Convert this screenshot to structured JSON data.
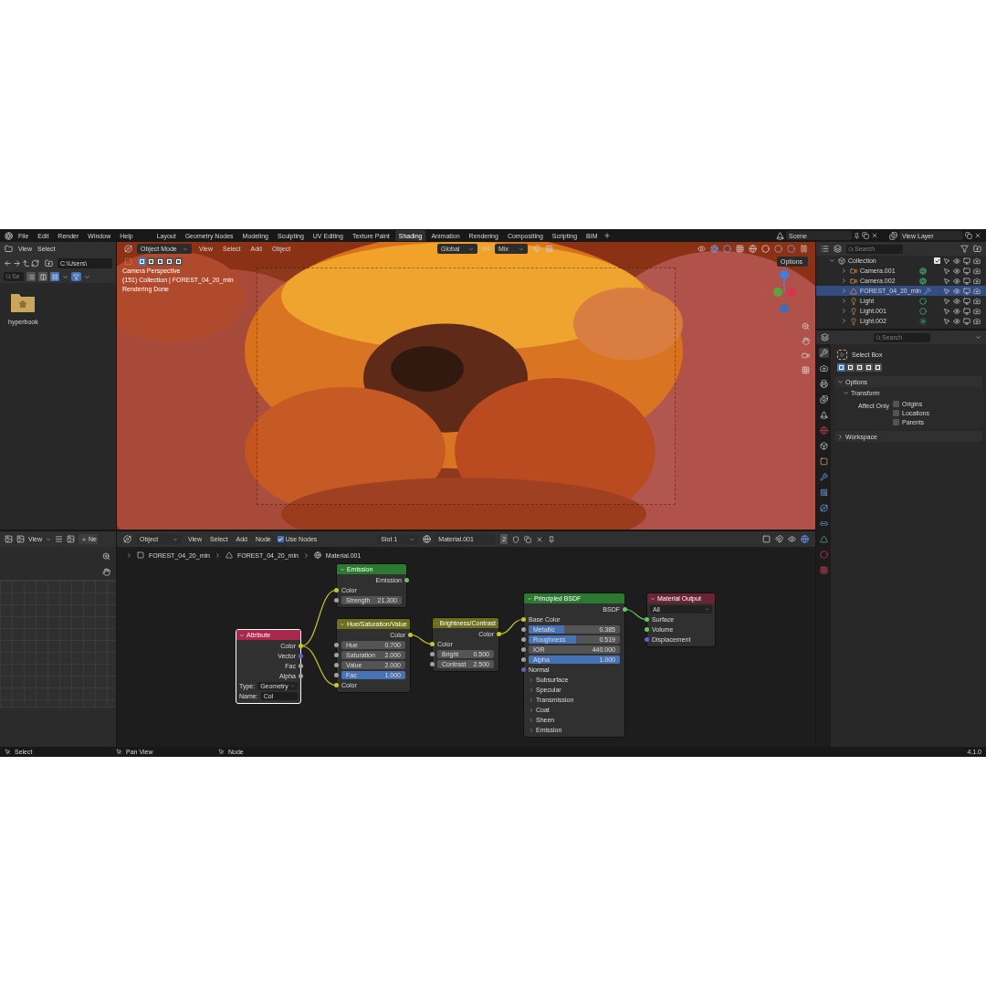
{
  "menu": [
    "File",
    "Edit",
    "Render",
    "Window",
    "Help"
  ],
  "workspaces": [
    {
      "label": "Layout",
      "selected": false
    },
    {
      "label": "Geometry Nodes",
      "selected": false
    },
    {
      "label": "Modeling",
      "selected": false
    },
    {
      "label": "Sculpting",
      "selected": false
    },
    {
      "label": "UV Editing",
      "selected": false
    },
    {
      "label": "Texture Paint",
      "selected": false
    },
    {
      "label": "Shading",
      "selected": true
    },
    {
      "label": "Animation",
      "selected": false
    },
    {
      "label": "Rendering",
      "selected": false
    },
    {
      "label": "Compositing",
      "selected": false
    },
    {
      "label": "Scripting",
      "selected": false
    },
    {
      "label": "BIM",
      "selected": false
    }
  ],
  "scene": "Scene",
  "view_layer": "View Layer",
  "file_browser": {
    "menus": [
      "View",
      "Select"
    ],
    "path": "C:\\Users\\",
    "search_placeholder": "Se",
    "display_modes": [
      {
        "selected": false
      },
      {
        "selected": false
      },
      {
        "selected": true
      }
    ],
    "items": [
      {
        "label": "hyperbook"
      }
    ]
  },
  "viewport": {
    "mode": "Object Mode",
    "menus": [
      "View",
      "Select",
      "Add",
      "Object"
    ],
    "orientation": "Global",
    "proportional": "Mix",
    "select_modes": [
      {
        "selected": true
      },
      {
        "selected": false
      },
      {
        "selected": false
      },
      {
        "selected": false
      },
      {
        "selected": false
      }
    ],
    "options": "Options",
    "info": [
      "Camera Perspective",
      "(151) Collection | FOREST_04_20_mln",
      "Rendering Done"
    ]
  },
  "outliner": {
    "search_placeholder": "Search",
    "collection": {
      "name": "Collection",
      "checked": true
    },
    "items": [
      {
        "name": "Camera.001",
        "kind": "camera",
        "selected": false
      },
      {
        "name": "Camera.002",
        "kind": "camera",
        "selected": false
      },
      {
        "name": "FOREST_04_20_mln",
        "kind": "mesh",
        "selected": true
      },
      {
        "name": "Light",
        "kind": "light",
        "selected": false
      },
      {
        "name": "Light.001",
        "kind": "light",
        "selected": false
      },
      {
        "name": "Light.002",
        "kind": "sun",
        "selected": false
      }
    ]
  },
  "properties": {
    "search_placeholder": "Search",
    "tool": "Select Box",
    "select_modes": [
      {
        "selected": true
      },
      {
        "selected": false
      },
      {
        "selected": false
      },
      {
        "selected": false
      },
      {
        "selected": false
      }
    ],
    "options": {
      "title": "Options",
      "expanded": true
    },
    "transform": {
      "title": "Transform",
      "expanded": true
    },
    "affect_only": "Affect Only",
    "checkboxes": [
      {
        "label": "Origins",
        "checked": false
      },
      {
        "label": "Locations",
        "checked": false
      },
      {
        "label": "Parents",
        "checked": false
      }
    ],
    "workspace": {
      "title": "Workspace",
      "expanded": false
    }
  },
  "image_editor": {
    "menu": "View",
    "new_button": "Ne"
  },
  "node_editor": {
    "object": "Object",
    "menus": [
      "View",
      "Select",
      "Add",
      "Node"
    ],
    "use_nodes": {
      "label": "Use Nodes",
      "checked": true
    },
    "slot": "Slot 1",
    "material": "Material.001",
    "users": "2",
    "breadcrumbs": [
      "FOREST_04_20_mln",
      "FOREST_04_20_mln",
      "Material.001"
    ],
    "nodes": [
      {
        "title": "Emission",
        "color": "#2c7a32",
        "selected": false,
        "rows": [
          {
            "kind": "output",
            "label": "Emission",
            "color": "#63c763"
          },
          {
            "kind": "input",
            "label": "Color",
            "color": "#c7c729"
          },
          {
            "kind": "value",
            "label": "Strength",
            "value": "21.300",
            "color": "#a1a1a1"
          }
        ]
      },
      {
        "title": "Attribute",
        "color": "#a8294d",
        "selected": true,
        "rows": [
          {
            "kind": "output",
            "label": "Color",
            "color": "#c7c729"
          },
          {
            "kind": "output",
            "label": "Vector",
            "color": "#6363c7"
          },
          {
            "kind": "output",
            "label": "Fac",
            "color": "#a1a1a1"
          },
          {
            "kind": "output",
            "label": "Alpha",
            "color": "#a1a1a1"
          },
          {
            "kind": "dropdown",
            "label": "Type:",
            "value": "Geometry"
          },
          {
            "kind": "text",
            "label": "Name:",
            "value": "Col"
          }
        ]
      },
      {
        "title": "Hue/Saturation/Value",
        "color": "#6e6e1d",
        "selected": false,
        "rows": [
          {
            "kind": "output",
            "label": "Color",
            "color": "#c7c729"
          },
          {
            "kind": "value",
            "label": "Hue",
            "value": "0.700",
            "color": "#a1a1a1"
          },
          {
            "kind": "value",
            "label": "Saturation",
            "value": "2.000",
            "color": "#a1a1a1"
          },
          {
            "kind": "value",
            "label": "Value",
            "value": "2.000",
            "color": "#a1a1a1"
          },
          {
            "kind": "value",
            "label": "Fac",
            "value": "1.000",
            "color": "#a1a1a1",
            "level": 1
          },
          {
            "kind": "input",
            "label": "Color",
            "color": "#c7c729"
          }
        ]
      },
      {
        "title": "Brightness/Contrast",
        "color": "#6e6e1d",
        "selected": false,
        "rows": [
          {
            "kind": "output",
            "label": "Color",
            "color": "#c7c729"
          },
          {
            "kind": "input",
            "label": "Color",
            "color": "#c7c729"
          },
          {
            "kind": "value",
            "label": "Bright",
            "value": "0.500",
            "color": "#a1a1a1"
          },
          {
            "kind": "value",
            "label": "Contrast",
            "value": "2.500",
            "color": "#a1a1a1"
          }
        ]
      },
      {
        "title": "Principled BSDF",
        "color": "#2c7a32",
        "selected": false,
        "rows": [
          {
            "kind": "output",
            "label": "BSDF",
            "color": "#63c763"
          },
          {
            "kind": "input",
            "label": "Base Color",
            "color": "#c7c729"
          },
          {
            "kind": "value",
            "label": "Metallic",
            "value": "0.385",
            "color": "#a1a1a1",
            "level": 0.385
          },
          {
            "kind": "value",
            "label": "Roughness",
            "value": "0.519",
            "color": "#a1a1a1",
            "level": 0.519
          },
          {
            "kind": "value",
            "label": "IOR",
            "value": "440.000",
            "color": "#a1a1a1"
          },
          {
            "kind": "value",
            "label": "Alpha",
            "value": "1.000",
            "color": "#a1a1a1",
            "level": 1
          },
          {
            "kind": "input",
            "label": "Normal",
            "color": "#6363c7"
          },
          {
            "kind": "panel",
            "label": "Subsurface",
            "expanded": false
          },
          {
            "kind": "panel",
            "label": "Specular",
            "expanded": false
          },
          {
            "kind": "panel",
            "label": "Transmission",
            "expanded": false
          },
          {
            "kind": "panel",
            "label": "Coat",
            "expanded": false
          },
          {
            "kind": "panel",
            "label": "Sheen",
            "expanded": false
          },
          {
            "kind": "panel",
            "label": "Emission",
            "expanded": false
          }
        ]
      },
      {
        "title": "Material Output",
        "color": "#6b2434",
        "selected": false,
        "rows": [
          {
            "kind": "dropdown",
            "value": "All"
          },
          {
            "kind": "input",
            "label": "Surface",
            "color": "#63c763"
          },
          {
            "kind": "input",
            "label": "Volume",
            "color": "#63c763"
          },
          {
            "kind": "input",
            "label": "Displacement",
            "color": "#6363c7"
          }
        ]
      }
    ]
  },
  "status_bar": {
    "hints": [
      "Select",
      "Pan View",
      "Node"
    ],
    "version": "4.1.0"
  }
}
